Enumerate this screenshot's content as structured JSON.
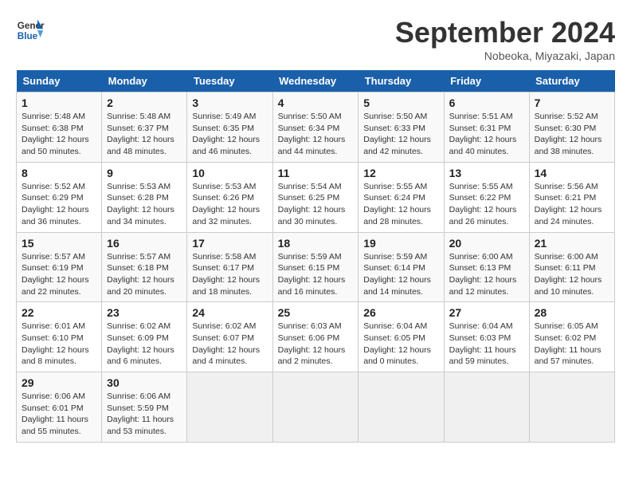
{
  "header": {
    "logo_line1": "General",
    "logo_line2": "Blue",
    "title": "September 2024",
    "location": "Nobeoka, Miyazaki, Japan"
  },
  "calendar": {
    "days_of_week": [
      "Sunday",
      "Monday",
      "Tuesday",
      "Wednesday",
      "Thursday",
      "Friday",
      "Saturday"
    ],
    "weeks": [
      [
        {
          "day": "",
          "detail": ""
        },
        {
          "day": "2",
          "detail": "Sunrise: 5:48 AM\nSunset: 6:37 PM\nDaylight: 12 hours\nand 48 minutes."
        },
        {
          "day": "3",
          "detail": "Sunrise: 5:49 AM\nSunset: 6:35 PM\nDaylight: 12 hours\nand 46 minutes."
        },
        {
          "day": "4",
          "detail": "Sunrise: 5:50 AM\nSunset: 6:34 PM\nDaylight: 12 hours\nand 44 minutes."
        },
        {
          "day": "5",
          "detail": "Sunrise: 5:50 AM\nSunset: 6:33 PM\nDaylight: 12 hours\nand 42 minutes."
        },
        {
          "day": "6",
          "detail": "Sunrise: 5:51 AM\nSunset: 6:31 PM\nDaylight: 12 hours\nand 40 minutes."
        },
        {
          "day": "7",
          "detail": "Sunrise: 5:52 AM\nSunset: 6:30 PM\nDaylight: 12 hours\nand 38 minutes."
        }
      ],
      [
        {
          "day": "1",
          "detail": "Sunrise: 5:48 AM\nSunset: 6:38 PM\nDaylight: 12 hours\nand 50 minutes."
        },
        {
          "day": "9",
          "detail": "Sunrise: 5:53 AM\nSunset: 6:28 PM\nDaylight: 12 hours\nand 34 minutes."
        },
        {
          "day": "10",
          "detail": "Sunrise: 5:53 AM\nSunset: 6:26 PM\nDaylight: 12 hours\nand 32 minutes."
        },
        {
          "day": "11",
          "detail": "Sunrise: 5:54 AM\nSunset: 6:25 PM\nDaylight: 12 hours\nand 30 minutes."
        },
        {
          "day": "12",
          "detail": "Sunrise: 5:55 AM\nSunset: 6:24 PM\nDaylight: 12 hours\nand 28 minutes."
        },
        {
          "day": "13",
          "detail": "Sunrise: 5:55 AM\nSunset: 6:22 PM\nDaylight: 12 hours\nand 26 minutes."
        },
        {
          "day": "14",
          "detail": "Sunrise: 5:56 AM\nSunset: 6:21 PM\nDaylight: 12 hours\nand 24 minutes."
        }
      ],
      [
        {
          "day": "8",
          "detail": "Sunrise: 5:52 AM\nSunset: 6:29 PM\nDaylight: 12 hours\nand 36 minutes."
        },
        {
          "day": "16",
          "detail": "Sunrise: 5:57 AM\nSunset: 6:18 PM\nDaylight: 12 hours\nand 20 minutes."
        },
        {
          "day": "17",
          "detail": "Sunrise: 5:58 AM\nSunset: 6:17 PM\nDaylight: 12 hours\nand 18 minutes."
        },
        {
          "day": "18",
          "detail": "Sunrise: 5:59 AM\nSunset: 6:15 PM\nDaylight: 12 hours\nand 16 minutes."
        },
        {
          "day": "19",
          "detail": "Sunrise: 5:59 AM\nSunset: 6:14 PM\nDaylight: 12 hours\nand 14 minutes."
        },
        {
          "day": "20",
          "detail": "Sunrise: 6:00 AM\nSunset: 6:13 PM\nDaylight: 12 hours\nand 12 minutes."
        },
        {
          "day": "21",
          "detail": "Sunrise: 6:00 AM\nSunset: 6:11 PM\nDaylight: 12 hours\nand 10 minutes."
        }
      ],
      [
        {
          "day": "15",
          "detail": "Sunrise: 5:57 AM\nSunset: 6:19 PM\nDaylight: 12 hours\nand 22 minutes."
        },
        {
          "day": "23",
          "detail": "Sunrise: 6:02 AM\nSunset: 6:09 PM\nDaylight: 12 hours\nand 6 minutes."
        },
        {
          "day": "24",
          "detail": "Sunrise: 6:02 AM\nSunset: 6:07 PM\nDaylight: 12 hours\nand 4 minutes."
        },
        {
          "day": "25",
          "detail": "Sunrise: 6:03 AM\nSunset: 6:06 PM\nDaylight: 12 hours\nand 2 minutes."
        },
        {
          "day": "26",
          "detail": "Sunrise: 6:04 AM\nSunset: 6:05 PM\nDaylight: 12 hours\nand 0 minutes."
        },
        {
          "day": "27",
          "detail": "Sunrise: 6:04 AM\nSunset: 6:03 PM\nDaylight: 11 hours\nand 59 minutes."
        },
        {
          "day": "28",
          "detail": "Sunrise: 6:05 AM\nSunset: 6:02 PM\nDaylight: 11 hours\nand 57 minutes."
        }
      ],
      [
        {
          "day": "22",
          "detail": "Sunrise: 6:01 AM\nSunset: 6:10 PM\nDaylight: 12 hours\nand 8 minutes."
        },
        {
          "day": "30",
          "detail": "Sunrise: 6:06 AM\nSunset: 5:59 PM\nDaylight: 11 hours\nand 53 minutes."
        },
        {
          "day": "",
          "detail": ""
        },
        {
          "day": "",
          "detail": ""
        },
        {
          "day": "",
          "detail": ""
        },
        {
          "day": "",
          "detail": ""
        },
        {
          "day": "",
          "detail": ""
        }
      ],
      [
        {
          "day": "29",
          "detail": "Sunrise: 6:06 AM\nSunset: 6:01 PM\nDaylight: 11 hours\nand 55 minutes."
        },
        {
          "day": "",
          "detail": ""
        },
        {
          "day": "",
          "detail": ""
        },
        {
          "day": "",
          "detail": ""
        },
        {
          "day": "",
          "detail": ""
        },
        {
          "day": "",
          "detail": ""
        },
        {
          "day": "",
          "detail": ""
        }
      ]
    ]
  }
}
